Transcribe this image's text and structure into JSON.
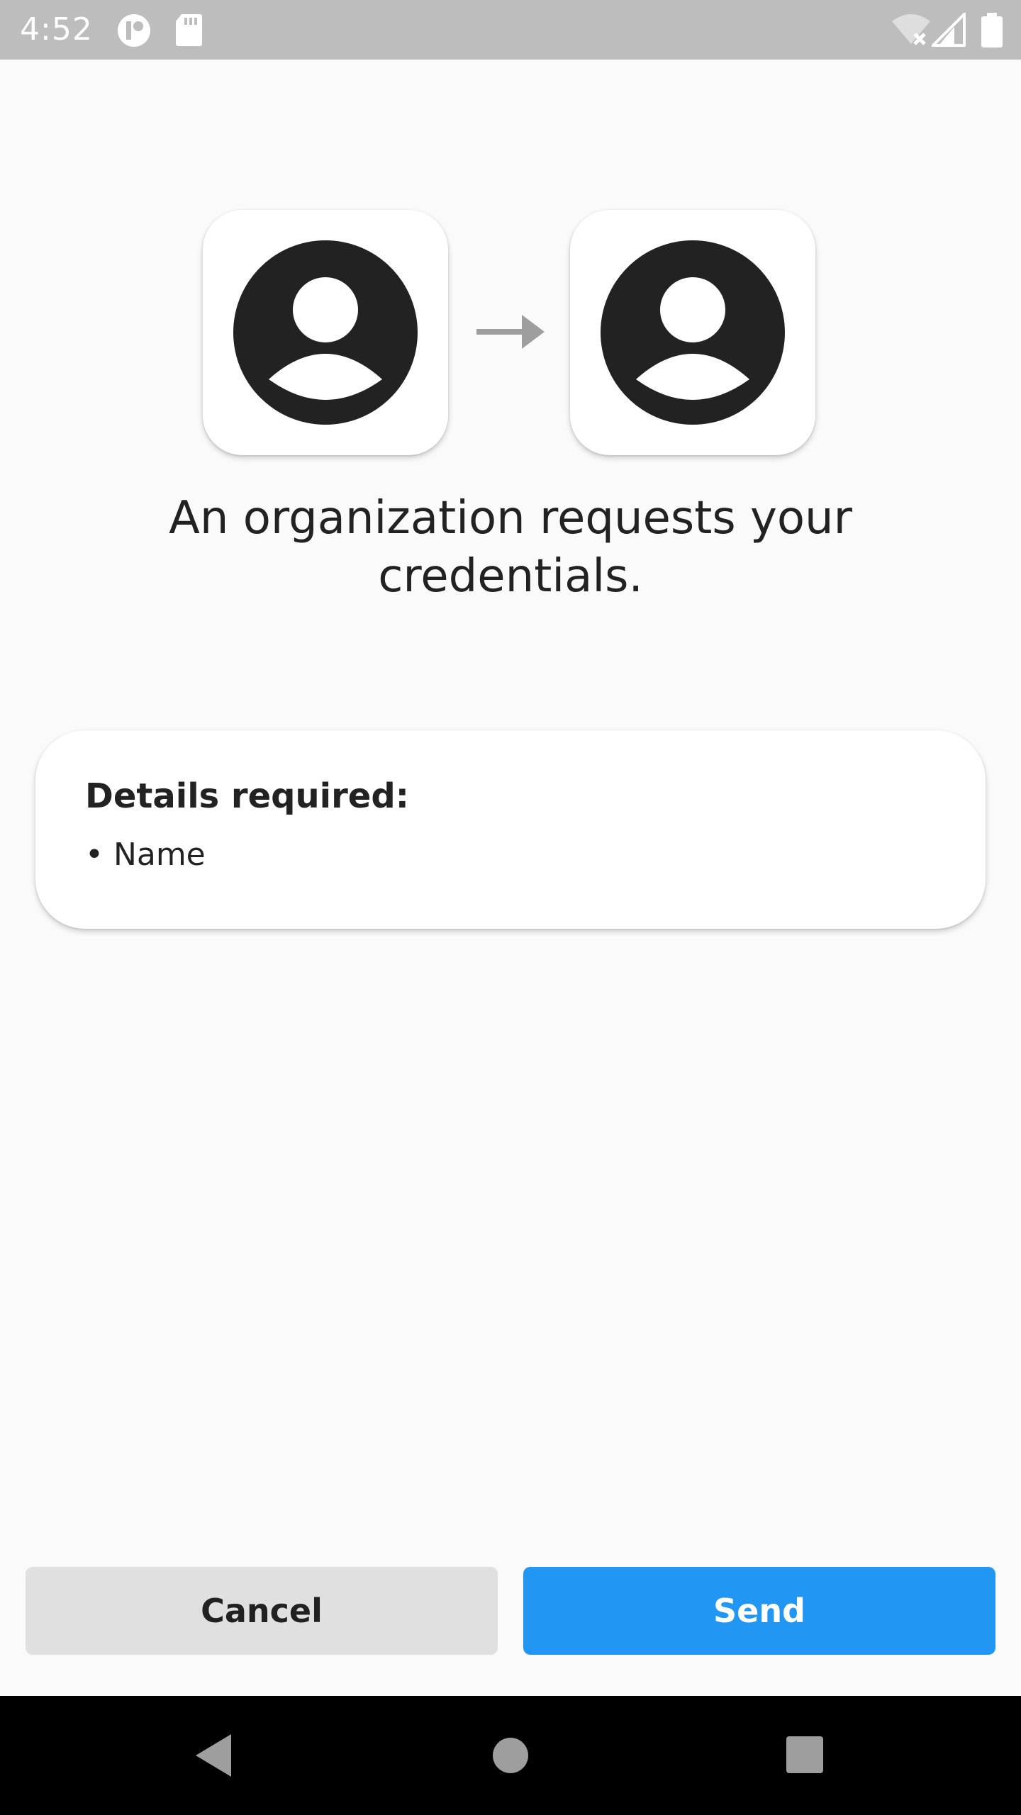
{
  "status_bar": {
    "time": "4:52",
    "icons": [
      "media-app-icon",
      "sd-card-icon",
      "wifi-off-icon",
      "cellular-signal-icon",
      "battery-icon"
    ]
  },
  "hero": {
    "left_icon": "account-circle-icon",
    "arrow_icon": "arrow-right-icon",
    "right_icon": "account-circle-icon",
    "headline": "An organization requests your credentials."
  },
  "details": {
    "title": "Details required:",
    "items": [
      "• Name"
    ]
  },
  "actions": {
    "cancel_label": "Cancel",
    "send_label": "Send"
  },
  "nav_bar": {
    "icons": [
      "back-icon",
      "home-icon",
      "recents-icon"
    ]
  },
  "colors": {
    "accent": "#2196f3",
    "cancel_bg": "#e0e0e0",
    "status_bar": "#bdbdbd",
    "background": "#fafafa"
  }
}
